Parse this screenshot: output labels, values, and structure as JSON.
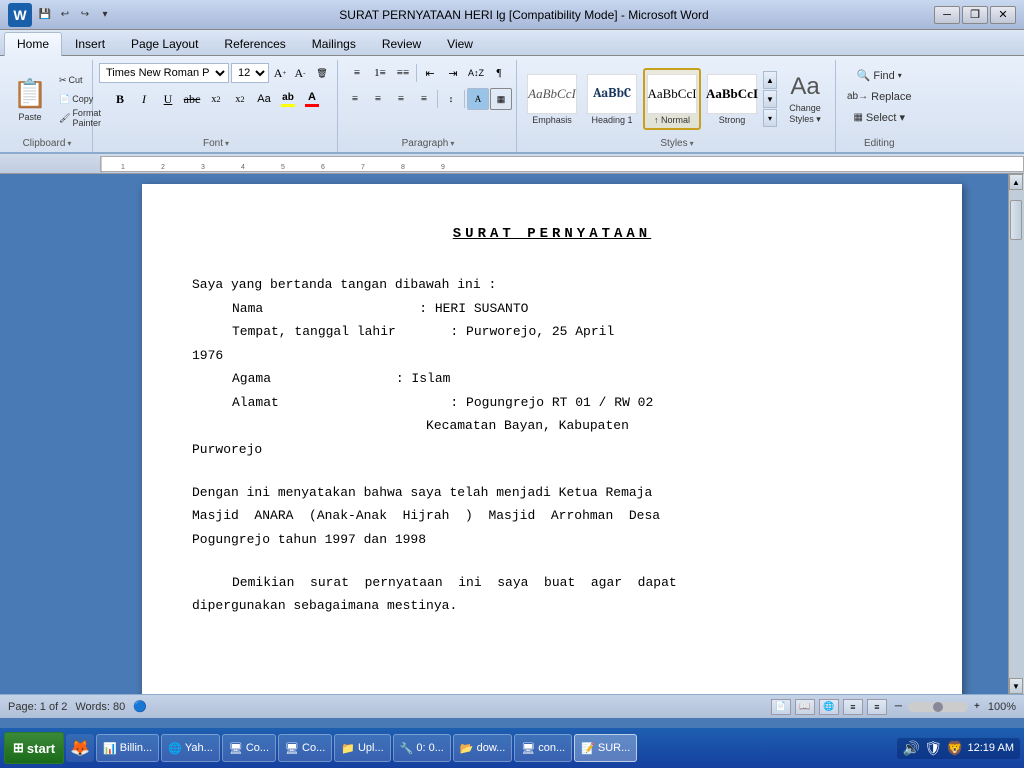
{
  "titleBar": {
    "title": "SURAT PERNYATAAN HERI lg [Compatibility Mode] - Microsoft Word",
    "minimizeLabel": "─",
    "restoreLabel": "❐",
    "closeLabel": "✕"
  },
  "ribbonTabs": {
    "tabs": [
      "Home",
      "Insert",
      "Page Layout",
      "References",
      "Mailings",
      "Review",
      "View"
    ],
    "activeTab": "Home"
  },
  "ribbon": {
    "clipboard": {
      "label": "Clipboard",
      "paste": "Paste",
      "cut": "Cut",
      "copy": "Copy",
      "formatPainter": "Format Painter"
    },
    "font": {
      "label": "Font",
      "fontName": "Times New Roman PS M",
      "fontSize": "12",
      "bold": "B",
      "italic": "I",
      "underline": "U",
      "strikethrough": "abc",
      "subscript": "x₂",
      "superscript": "x²",
      "changeCase": "Aa",
      "highlightColor": "A",
      "fontColor": "A"
    },
    "paragraph": {
      "label": "Paragraph"
    },
    "styles": {
      "label": "Styles",
      "items": [
        {
          "name": "Emphasis",
          "preview": "AaBbCcI",
          "active": false
        },
        {
          "name": "Heading 1",
          "preview": "AaBbC",
          "active": false
        },
        {
          "name": "↑ Normal",
          "preview": "AaBbCcI",
          "active": true
        },
        {
          "name": "Strong",
          "preview": "AaBbCcI",
          "active": false
        }
      ],
      "changeStyles": "Change\nStyles"
    },
    "editing": {
      "label": "Editing",
      "find": "Find",
      "replace": "Replace",
      "select": "Select ▾"
    }
  },
  "document": {
    "title": "SURAT  PERNYATAAN",
    "lines": [
      "Saya yang bertanda tangan dibawah ini :",
      "    Nama                    : HERI SUSANTO",
      "    Tempat, tanggal lahir        : Purworejo, 25 April",
      "1976",
      "    Agama                   : Islam",
      "    Alamat                       : Pogungrejo RT 01 / RW 02",
      "                               Kecamatan Bayan, Kabupaten",
      "Purworejo",
      "",
      "Dengan ini menyatakan bahwa saya telah menjadi Ketua Remaja",
      "Masjid  ANARA  (Anak-Anak  Hijrah  )  Masjid  Arrohman  Desa",
      "Pogungrejo tahun 1997 dan 1998",
      "",
      "    Demikian  surat  pernyataan  ini  saya  buat  agar  dapat",
      "dipergunakan sebagaimana mestinya."
    ]
  },
  "statusBar": {
    "page": "Page: 1 of 2",
    "words": "Words: 80",
    "zoom": "100%"
  },
  "taskbar": {
    "start": "start",
    "buttons": [
      {
        "label": "Billin...",
        "icon": "📊"
      },
      {
        "label": "Yah...",
        "icon": "🌐"
      },
      {
        "label": "Co...",
        "icon": "🖥"
      },
      {
        "label": "Co...",
        "icon": "🖥"
      },
      {
        "label": "Upl...",
        "icon": "📁"
      },
      {
        "label": "0: 0...",
        "icon": "🔧"
      },
      {
        "label": "dow...",
        "icon": "📂"
      },
      {
        "label": "con...",
        "icon": "🖥"
      },
      {
        "label": "SUR...",
        "icon": "📝",
        "active": true
      }
    ],
    "time": "12:19 AM",
    "trayIcons": [
      "🔊",
      "🌐",
      "🛡"
    ]
  }
}
